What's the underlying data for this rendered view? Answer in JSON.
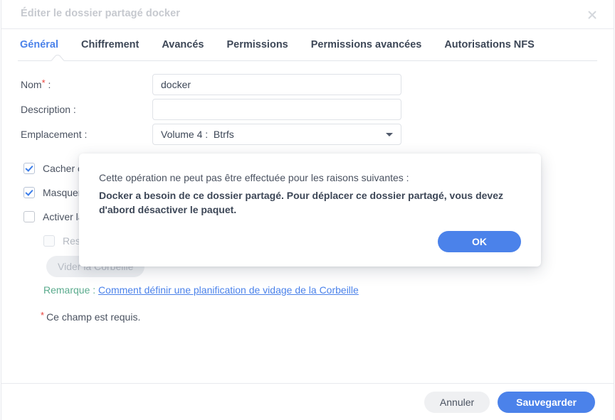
{
  "window": {
    "title": "Éditer le dossier partagé docker",
    "close_icon": "close-icon"
  },
  "tabs": [
    {
      "label": "Général",
      "active": true
    },
    {
      "label": "Chiffrement",
      "active": false
    },
    {
      "label": "Avancés",
      "active": false
    },
    {
      "label": "Permissions",
      "active": false
    },
    {
      "label": "Permissions avancées",
      "active": false
    },
    {
      "label": "Autorisations NFS",
      "active": false
    }
  ],
  "form": {
    "name": {
      "label": "Nom",
      "required_mark": "*",
      "colon": ":",
      "value": "docker",
      "placeholder": ""
    },
    "description": {
      "label": "Description :",
      "value": "",
      "placeholder": ""
    },
    "location": {
      "label": "Emplacement :",
      "value": "Volume 4 :  Btrfs",
      "caret_icon": "chevron-down-icon"
    }
  },
  "options": [
    {
      "label": "Cacher ce dossier partagé dans \"Mes emplacements réseaux\"",
      "checked": true,
      "disabled": false,
      "indent": false
    },
    {
      "label": "Masquer les sous-dossiers et les fichiers des utilisateurs sans autorisations",
      "checked": true,
      "disabled": false,
      "indent": false
    },
    {
      "label": "Activer la Corbeille",
      "checked": false,
      "disabled": false,
      "indent": false
    },
    {
      "label": "Restreindre l'accès à la Corbeille aux administrateurs uniquement",
      "checked": false,
      "disabled": true,
      "indent": true
    }
  ],
  "empty_recycle_button": {
    "label": "Vider la Corbeille",
    "disabled": true
  },
  "note": {
    "label": "Remarque :",
    "link": "Comment définir une planification de vidage de la Corbeille"
  },
  "required_note": {
    "star": "*",
    "text": "Ce champ est requis."
  },
  "footer": {
    "cancel_label": "Annuler",
    "save_label": "Sauvegarder"
  },
  "modal": {
    "line1": "Cette opération ne peut pas être effectuée pour les raisons suivantes :",
    "line2": "Docker a besoin de ce dossier partagé. Pour déplacer ce dossier partagé, vous devez d'abord désactiver le paquet.",
    "ok_label": "OK"
  },
  "colors": {
    "accent": "#4b82ea",
    "text": "#4a5260",
    "title": "#c6c9cf",
    "required": "#e8403a",
    "note_label": "#5aab8d"
  }
}
